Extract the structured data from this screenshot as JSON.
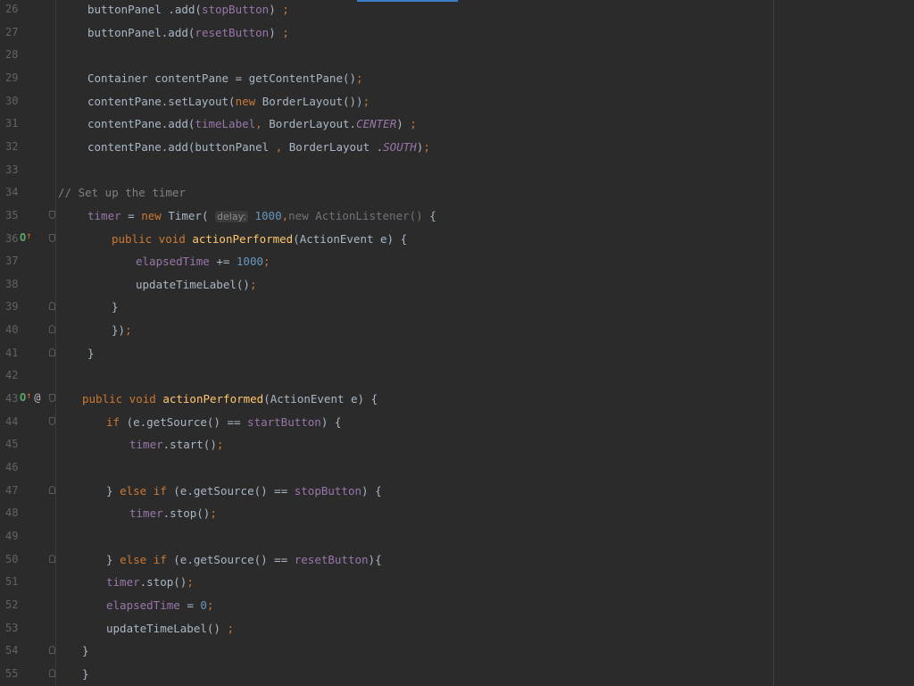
{
  "lines": [
    {
      "n": "26",
      "fold": "",
      "marks": "",
      "indent": 98,
      "tokens": [
        {
          "t": "buttonPanel .add(",
          "c": "plain"
        },
        {
          "t": "stopButton",
          "c": "field"
        },
        {
          "t": ") ",
          "c": "plain"
        },
        {
          "t": ";",
          "c": "kw"
        }
      ]
    },
    {
      "n": "27",
      "fold": "",
      "marks": "",
      "indent": 98,
      "tokens": [
        {
          "t": "buttonPanel.add(",
          "c": "plain"
        },
        {
          "t": "resetButton",
          "c": "field"
        },
        {
          "t": ") ",
          "c": "plain"
        },
        {
          "t": ";",
          "c": "kw"
        }
      ]
    },
    {
      "n": "28",
      "fold": "",
      "marks": "",
      "indent": 98,
      "tokens": []
    },
    {
      "n": "29",
      "fold": "",
      "marks": "",
      "indent": 98,
      "tokens": [
        {
          "t": "Container contentPane = getContentPane()",
          "c": "plain"
        },
        {
          "t": ";",
          "c": "kw"
        }
      ]
    },
    {
      "n": "30",
      "fold": "",
      "marks": "",
      "indent": 98,
      "tokens": [
        {
          "t": "contentPane.setLayout(",
          "c": "plain"
        },
        {
          "t": "new ",
          "c": "kw"
        },
        {
          "t": "BorderLayout())",
          "c": "plain"
        },
        {
          "t": ";",
          "c": "kw"
        }
      ]
    },
    {
      "n": "31",
      "fold": "",
      "marks": "",
      "indent": 98,
      "tokens": [
        {
          "t": "contentPane.add(",
          "c": "plain"
        },
        {
          "t": "timeLabel",
          "c": "field"
        },
        {
          "t": ", ",
          "c": "kw"
        },
        {
          "t": "BorderLayout.",
          "c": "plain"
        },
        {
          "t": "CENTER",
          "c": "fieldi"
        },
        {
          "t": ") ",
          "c": "plain"
        },
        {
          "t": ";",
          "c": "kw"
        }
      ]
    },
    {
      "n": "32",
      "fold": "",
      "marks": "",
      "indent": 98,
      "tokens": [
        {
          "t": "contentPane.add(buttonPanel ",
          "c": "plain"
        },
        {
          "t": ", ",
          "c": "kw"
        },
        {
          "t": "BorderLayout .",
          "c": "plain"
        },
        {
          "t": "SOUTH",
          "c": "fieldi"
        },
        {
          "t": ")",
          "c": "plain"
        },
        {
          "t": ";",
          "c": "kw"
        }
      ]
    },
    {
      "n": "33",
      "fold": "",
      "marks": "",
      "indent": 98,
      "tokens": []
    },
    {
      "n": "34",
      "fold": "",
      "marks": "",
      "indent": 65,
      "tokens": [
        {
          "t": "// Set up the timer",
          "c": "comment"
        }
      ]
    },
    {
      "n": "35",
      "fold": "open",
      "marks": "",
      "indent": 98,
      "tokens": [
        {
          "t": "timer",
          "c": "field"
        },
        {
          "t": " = ",
          "c": "plain"
        },
        {
          "t": "new ",
          "c": "kw"
        },
        {
          "t": "Timer( ",
          "c": "plain"
        },
        {
          "t": "delay:",
          "c": "hint"
        },
        {
          "t": " 1000",
          "c": "num"
        },
        {
          "t": ",",
          "c": "kw"
        },
        {
          "t": "new ActionListener()",
          "c": "gray"
        },
        {
          "t": " {",
          "c": "plain"
        }
      ]
    },
    {
      "n": "36",
      "fold": "open",
      "marks": "override",
      "indent": 125,
      "tokens": [
        {
          "t": "public void ",
          "c": "kw"
        },
        {
          "t": "actionPerformed",
          "c": "method"
        },
        {
          "t": "(ActionEvent e) {",
          "c": "plain"
        }
      ]
    },
    {
      "n": "37",
      "fold": "",
      "marks": "",
      "indent": 152,
      "tokens": [
        {
          "t": "elapsedTime",
          "c": "field"
        },
        {
          "t": " += ",
          "c": "plain"
        },
        {
          "t": "1000",
          "c": "num"
        },
        {
          "t": ";",
          "c": "kw"
        }
      ]
    },
    {
      "n": "38",
      "fold": "",
      "marks": "",
      "indent": 152,
      "tokens": [
        {
          "t": "updateTimeLabel()",
          "c": "plain"
        },
        {
          "t": ";",
          "c": "kw"
        }
      ]
    },
    {
      "n": "39",
      "fold": "end",
      "marks": "",
      "indent": 125,
      "tokens": [
        {
          "t": "}",
          "c": "plain"
        }
      ]
    },
    {
      "n": "40",
      "fold": "end",
      "marks": "",
      "indent": 125,
      "tokens": [
        {
          "t": "})",
          "c": "plain"
        },
        {
          "t": ";",
          "c": "kw"
        }
      ]
    },
    {
      "n": "41",
      "fold": "end",
      "marks": "",
      "indent": 98,
      "tokens": [
        {
          "t": "}",
          "c": "plain"
        }
      ]
    },
    {
      "n": "42",
      "fold": "",
      "marks": "",
      "indent": 98,
      "tokens": []
    },
    {
      "n": "43",
      "fold": "open",
      "marks": "override-at",
      "indent": 92,
      "tokens": [
        {
          "t": "public void ",
          "c": "kw"
        },
        {
          "t": "actionPerformed",
          "c": "method"
        },
        {
          "t": "(ActionEvent e) {",
          "c": "plain"
        }
      ]
    },
    {
      "n": "44",
      "fold": "open",
      "marks": "",
      "indent": 119,
      "tokens": [
        {
          "t": "if ",
          "c": "kw"
        },
        {
          "t": "(e.getSource() == ",
          "c": "plain"
        },
        {
          "t": "startButton",
          "c": "field"
        },
        {
          "t": ") {",
          "c": "plain"
        }
      ]
    },
    {
      "n": "45",
      "fold": "",
      "marks": "",
      "indent": 145,
      "tokens": [
        {
          "t": "timer",
          "c": "field"
        },
        {
          "t": ".start()",
          "c": "plain"
        },
        {
          "t": ";",
          "c": "kw"
        }
      ]
    },
    {
      "n": "46",
      "fold": "",
      "marks": "",
      "indent": 145,
      "tokens": []
    },
    {
      "n": "47",
      "fold": "end",
      "marks": "",
      "indent": 119,
      "tokens": [
        {
          "t": "} ",
          "c": "plain"
        },
        {
          "t": "else if ",
          "c": "kw"
        },
        {
          "t": "(e.getSource() == ",
          "c": "plain"
        },
        {
          "t": "stopButton",
          "c": "field"
        },
        {
          "t": ") {",
          "c": "plain"
        }
      ]
    },
    {
      "n": "48",
      "fold": "",
      "marks": "",
      "indent": 145,
      "tokens": [
        {
          "t": "timer",
          "c": "field"
        },
        {
          "t": ".stop()",
          "c": "plain"
        },
        {
          "t": ";",
          "c": "kw"
        }
      ]
    },
    {
      "n": "49",
      "fold": "",
      "marks": "",
      "indent": 145,
      "tokens": []
    },
    {
      "n": "50",
      "fold": "end",
      "marks": "",
      "indent": 119,
      "tokens": [
        {
          "t": "} ",
          "c": "plain"
        },
        {
          "t": "else if ",
          "c": "kw"
        },
        {
          "t": "(e.getSource() == ",
          "c": "plain"
        },
        {
          "t": "resetButton",
          "c": "field"
        },
        {
          "t": "){",
          "c": "plain"
        }
      ]
    },
    {
      "n": "51",
      "fold": "",
      "marks": "",
      "indent": 119,
      "tokens": [
        {
          "t": "timer",
          "c": "field"
        },
        {
          "t": ".stop()",
          "c": "plain"
        },
        {
          "t": ";",
          "c": "kw"
        }
      ]
    },
    {
      "n": "52",
      "fold": "",
      "marks": "",
      "indent": 119,
      "tokens": [
        {
          "t": "elapsedTime",
          "c": "field"
        },
        {
          "t": " = ",
          "c": "plain"
        },
        {
          "t": "0",
          "c": "num"
        },
        {
          "t": ";",
          "c": "kw"
        }
      ]
    },
    {
      "n": "53",
      "fold": "",
      "marks": "",
      "indent": 119,
      "tokens": [
        {
          "t": "updateTimeLabel() ",
          "c": "plain"
        },
        {
          "t": ";",
          "c": "kw"
        }
      ]
    },
    {
      "n": "54",
      "fold": "end",
      "marks": "",
      "indent": 92,
      "tokens": [
        {
          "t": "}",
          "c": "plain"
        }
      ]
    },
    {
      "n": "55",
      "fold": "end",
      "marks": "",
      "indent": 92,
      "tokens": [
        {
          "t": "}",
          "c": "plain"
        }
      ]
    }
  ],
  "gutter_marks": {
    "override_glyph": "O",
    "arrow_glyph": "↑",
    "annotation_glyph": "@"
  },
  "colors": {
    "background": "#2b2b2b",
    "plain": "#a9b7c6",
    "keyword": "#cc7832",
    "field": "#9876aa",
    "number": "#6897bb",
    "method": "#ffc66d",
    "comment": "#808080",
    "line_number": "#606366"
  }
}
